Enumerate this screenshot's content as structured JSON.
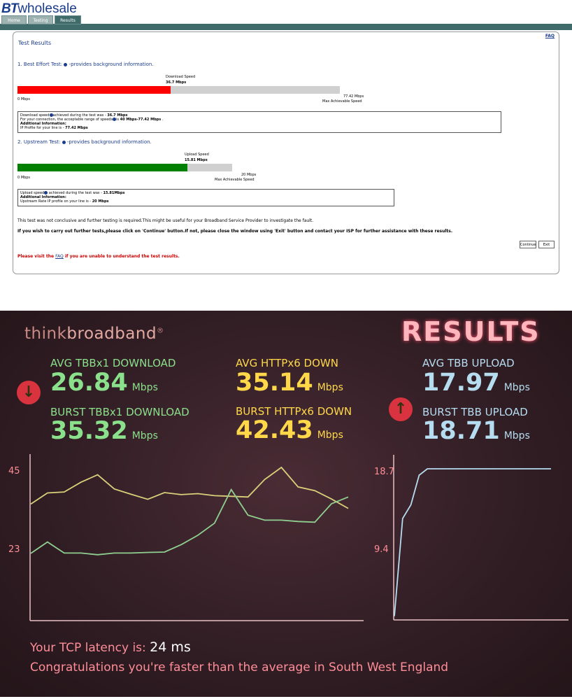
{
  "bt": {
    "logo_prefix": "BT",
    "logo_suffix": "wholesale",
    "tabs": [
      "Home",
      "Testing",
      "Results"
    ],
    "faq_label": "FAQ",
    "title": "Test Results",
    "colors": {
      "brand": "#1a3c8c",
      "bar_download": "#ff0000",
      "bar_upload": "#008000",
      "nav": "#3f6b6b"
    },
    "download": {
      "heading": "1. Best Effort Test:",
      "heading_suffix": "-provides background information.",
      "bar_title": "Download Speed",
      "bar_value": "36.7 Mbps",
      "fill_fraction": 0.474,
      "min_label": "0 Mbps",
      "max_value": "77.42 Mbps",
      "max_label": "Max Achievable Speed",
      "info_lines": [
        "Download speed",
        "achieved during the test was - ",
        "36.7 Mbps",
        "For your connection, the acceptable range of speeds",
        "is ",
        "40 Mbps-77.42 Mbps",
        " .",
        "Additional Information:",
        "IP Profile for your line is - ",
        "77.42 Mbps"
      ]
    },
    "upload": {
      "heading": "2. Upstream Test:",
      "heading_suffix": "-provides background information.",
      "bar_title": "Upload Speed",
      "bar_value": "15.81 Mbps",
      "fill_fraction": 0.79,
      "min_label": "0 Mbps",
      "max_value": "20 Mbps",
      "max_label": "Max Achievable Speed",
      "info_lines": [
        "Upload speed",
        " achieved during the test was - ",
        "15.81Mbps",
        "Additional Information:",
        "Upstream Rate IP profile on your line is - ",
        "20 Mbps"
      ]
    },
    "note": "This test was not conclusive and further testing is required.This might be useful for your Broadband Service Provider to investigate the fault.",
    "instruction": "If you wish to carry out further tests,please click on 'Continue' button.If not, please close the window using 'Exit' button and contact your ISP for further assistance with these results.",
    "continue_label": "Continue",
    "exit_label": "Exit",
    "visit_prefix": "Please visit the ",
    "visit_link": "FAQ",
    "visit_suffix": " if you are unable to understand the test results."
  },
  "tb": {
    "logo_thin": "think",
    "logo_bold": "broadband",
    "logo_reg": "®",
    "results_label": "RESULTS",
    "unit": "Mbps",
    "metrics": {
      "avg_tbb_download_label": "AVG TBBx1 DOWNLOAD",
      "avg_tbb_download_value": "26.84",
      "burst_tbb_download_label": "BURST TBBx1 DOWNLOAD",
      "burst_tbb_download_value": "35.32",
      "avg_http_down_label": "AVG HTTPx6 DOWN",
      "avg_http_down_value": "35.14",
      "burst_http_down_label": "BURST HTTPx6 DOWN",
      "burst_http_down_value": "42.43",
      "avg_tbb_upload_label": "AVG TBB UPLOAD",
      "avg_tbb_upload_value": "17.97",
      "burst_tbb_upload_label": "BURST TBB UPLOAD",
      "burst_tbb_upload_value": "18.71"
    },
    "latency_prefix": "Your TCP latency is: ",
    "latency_value": "24 ms",
    "congrats": "Congratulations you're faster than the average in South West England",
    "colors": {
      "green": "#8be08b",
      "yellow": "#ffd84a",
      "blue": "#b5dcef",
      "accent": "#ff8d97"
    }
  },
  "chart_data": [
    {
      "type": "line",
      "ylim": [
        0,
        45
      ],
      "yticks": [
        "45",
        "23"
      ],
      "x": [
        0,
        1,
        2,
        3,
        4,
        5,
        6,
        7,
        8,
        9,
        10,
        11,
        12,
        13,
        14,
        15,
        16,
        17,
        18,
        19
      ],
      "series": [
        {
          "color": "#d8d07a",
          "values": [
            34.3,
            37.6,
            37.9,
            40.8,
            43.0,
            38.8,
            37.2,
            35.7,
            37.7,
            37.1,
            37.4,
            36.8,
            36.6,
            36.4,
            41.6,
            45.2,
            39.4,
            38.3,
            35.8,
            33.0
          ]
        },
        {
          "color": "#8fcf8f",
          "values": [
            19.6,
            23.0,
            19.7,
            19.7,
            19.2,
            19.7,
            19.7,
            19.9,
            20.0,
            22.2,
            25.0,
            28.6,
            38.6,
            31.0,
            29.5,
            29.5,
            29.1,
            28.9,
            34.4,
            36.4
          ]
        }
      ]
    },
    {
      "type": "line",
      "ylim": [
        0,
        18.7
      ],
      "yticks": [
        "18.7",
        "9.4"
      ],
      "x": [
        0,
        1,
        2,
        3,
        4,
        5,
        6,
        7,
        8,
        9,
        10,
        11,
        12,
        13,
        14,
        15,
        16,
        17,
        18,
        19
      ],
      "series": [
        {
          "color": "#b5dcef",
          "values": [
            0.3,
            12.5,
            14.2,
            17.9,
            18.7,
            18.7,
            18.7,
            18.7,
            18.7,
            18.7,
            18.7,
            18.7,
            18.7,
            18.7,
            18.7,
            18.7,
            18.7,
            18.7,
            18.7,
            18.7
          ]
        }
      ]
    }
  ]
}
